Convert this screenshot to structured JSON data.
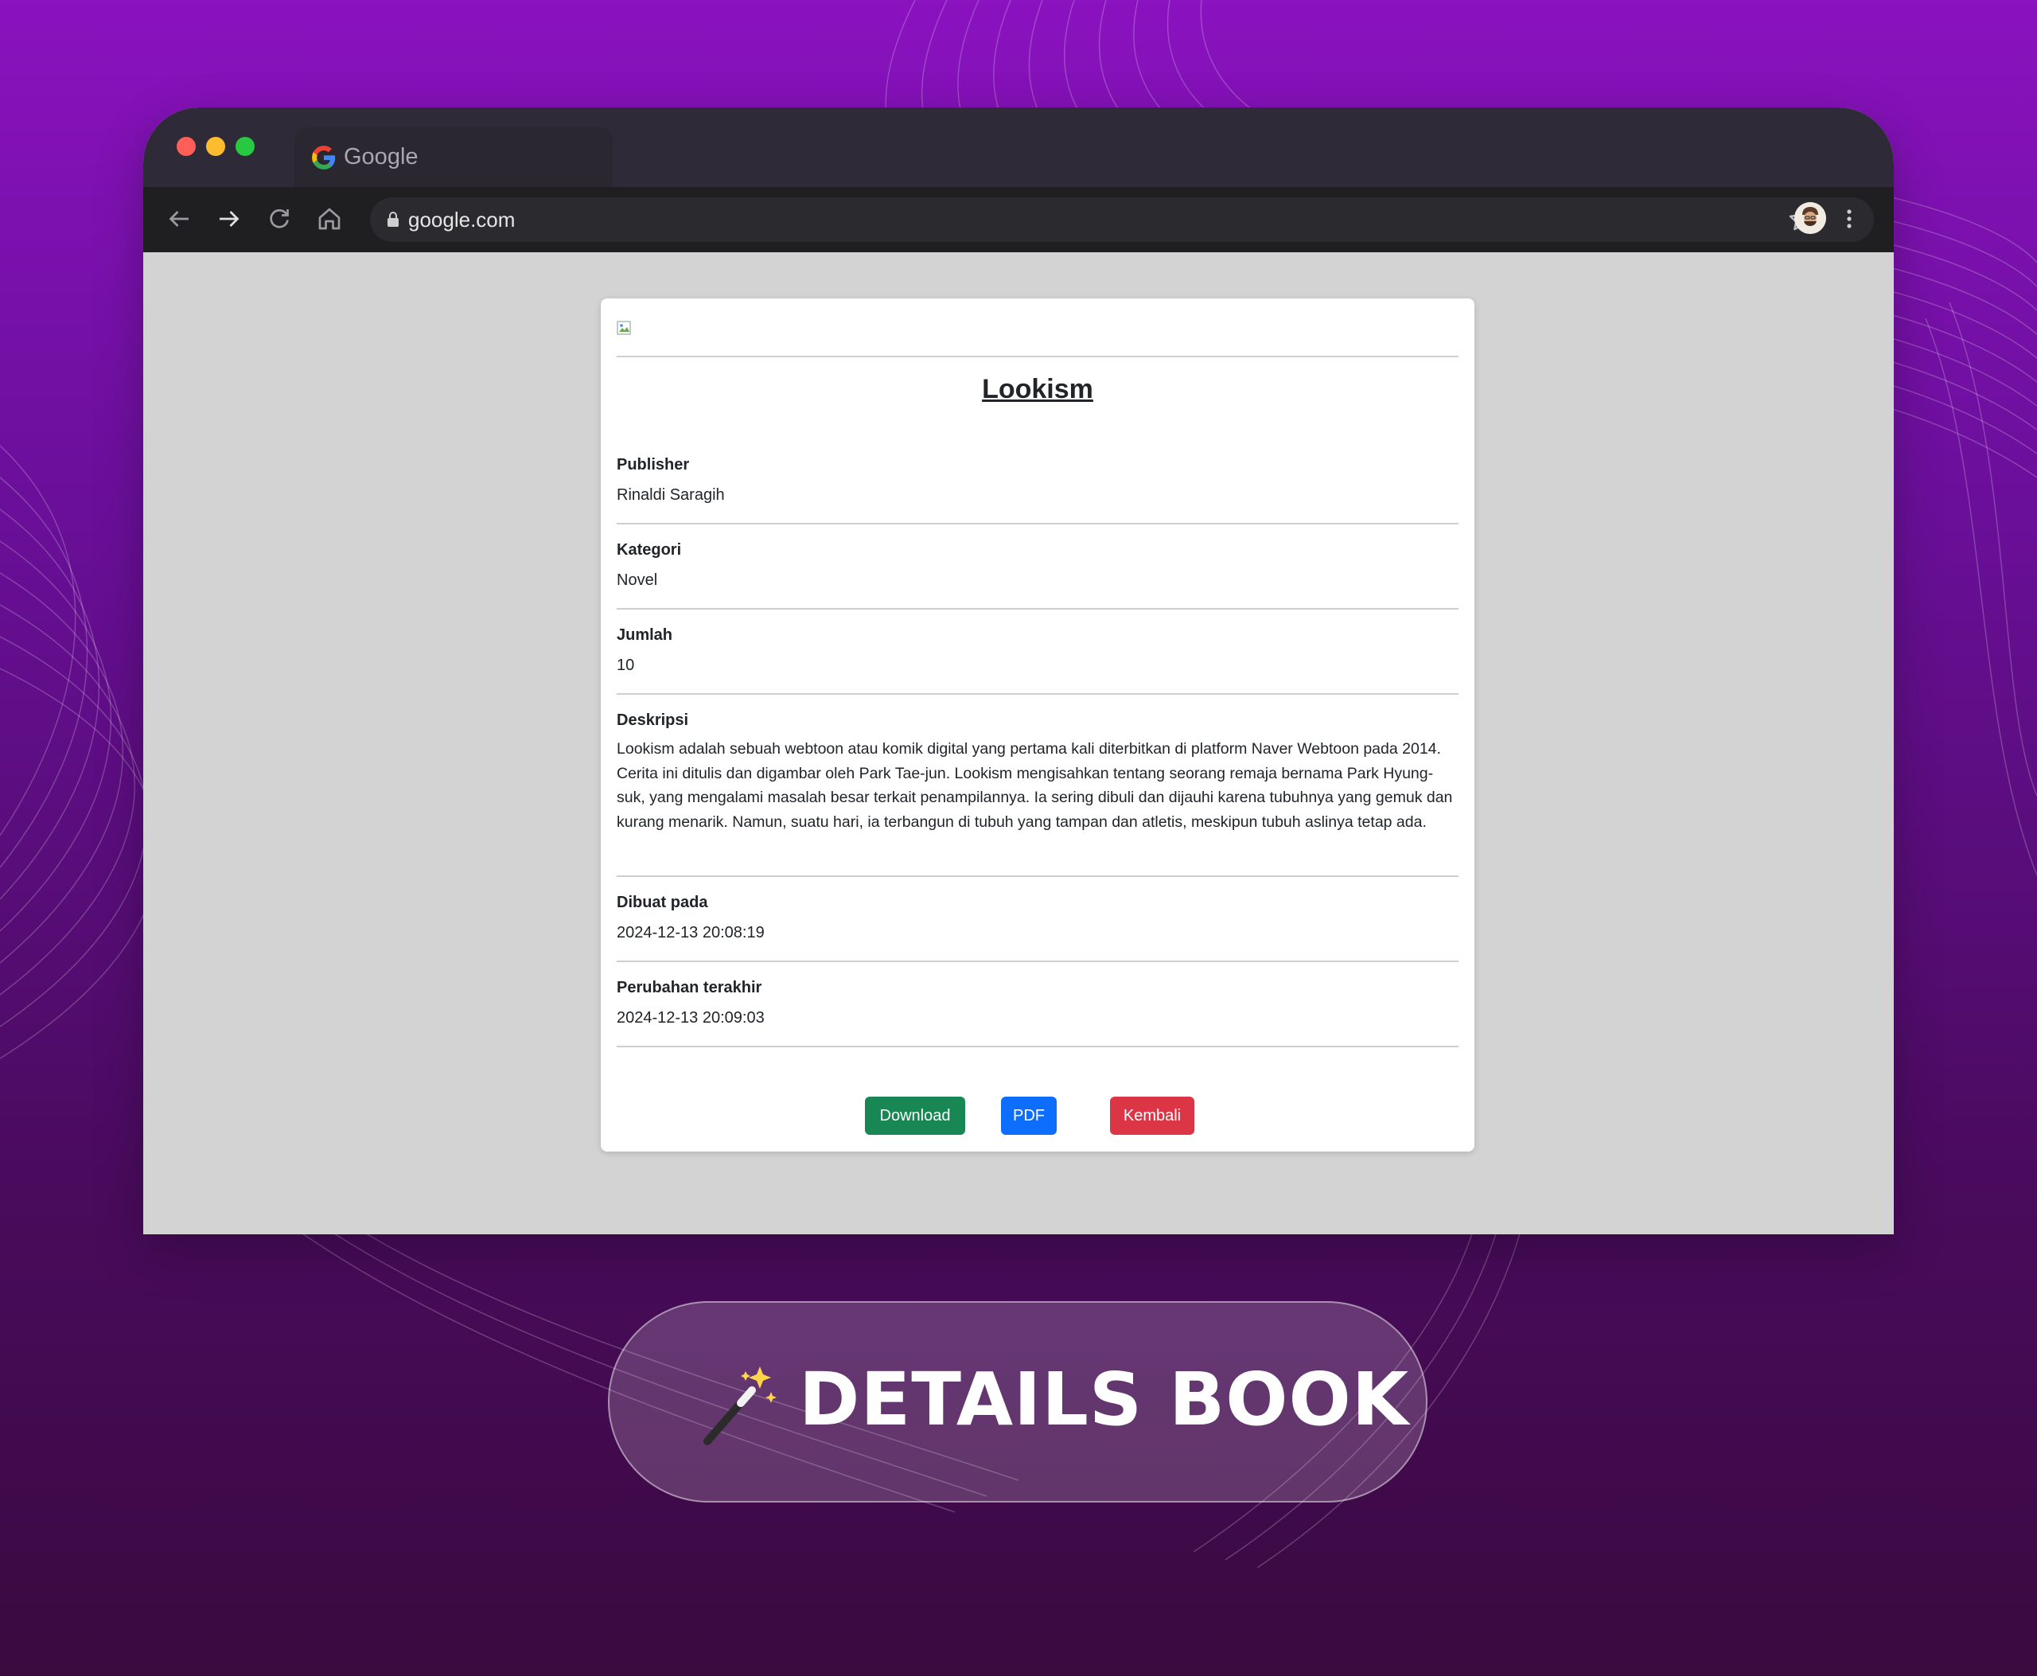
{
  "browser": {
    "tab_title": "Google",
    "url": "google.com"
  },
  "book": {
    "title": "Lookism",
    "fields": {
      "publisher_label": "Publisher",
      "publisher_value": "Rinaldi Saragih",
      "kategori_label": "Kategori",
      "kategori_value": "Novel",
      "jumlah_label": "Jumlah",
      "jumlah_value": "10",
      "deskripsi_label": "Deskripsi",
      "deskripsi_value": "Lookism adalah sebuah webtoon atau komik digital yang pertama kali diterbitkan di platform Naver Webtoon pada 2014. Cerita ini ditulis dan digambar oleh Park Tae-jun. Lookism mengisahkan tentang seorang remaja bernama Park Hyung-suk, yang mengalami masalah besar terkait penampilannya. Ia sering dibuli dan dijauhi karena tubuhnya yang gemuk dan kurang menarik. Namun, suatu hari, ia terbangun di tubuh yang tampan dan atletis, meskipun tubuh aslinya tetap ada.",
      "dibuat_label": "Dibuat pada",
      "dibuat_value": "2024-12-13 20:08:19",
      "perubahan_label": "Perubahan terakhir",
      "perubahan_value": "2024-12-13 20:09:03"
    },
    "buttons": {
      "download": "Download",
      "pdf": "PDF",
      "kembali": "Kembali"
    }
  },
  "banner": {
    "text": "DETAILS BOOK"
  },
  "colors": {
    "download": "#198754",
    "pdf": "#0d6efd",
    "kembali": "#dc3545"
  }
}
